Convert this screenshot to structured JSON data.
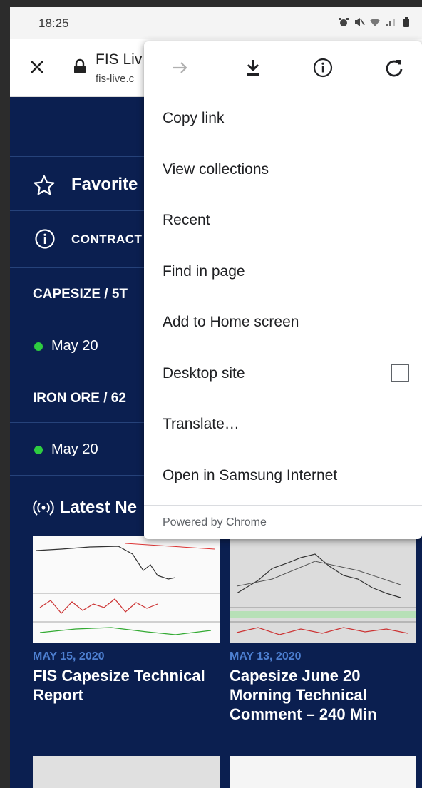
{
  "status_bar": {
    "time": "18:25",
    "icons": [
      "alarm-icon",
      "mute-icon",
      "wifi-icon",
      "signal-icon",
      "battery-icon"
    ]
  },
  "browser": {
    "page_title": "FIS Liv",
    "page_host": "fis-live.c"
  },
  "page": {
    "favorites_label": "Favorite",
    "contracts_label": "CONTRACT",
    "items": [
      {
        "name": "CAPESIZE / 5T",
        "date": "May 20"
      },
      {
        "name": "IRON ORE / 62",
        "date": "May 20"
      }
    ],
    "latest_news_label": "Latest Ne",
    "news": [
      {
        "date": "MAY 15, 2020",
        "title": "FIS Capesize Technical Report"
      },
      {
        "date": "MAY 13, 2020",
        "title": "Capesize June 20 Morning Technical Comment – 240 Min"
      }
    ]
  },
  "menu": {
    "top_icons": [
      "forward-arrow-icon",
      "download-icon",
      "info-icon",
      "refresh-icon"
    ],
    "items": [
      "Copy link",
      "View collections",
      "Recent",
      "Find in page",
      "Add to Home screen",
      "Desktop site",
      "Translate…",
      "Open in Samsung Internet"
    ],
    "desktop_site_checked": false,
    "powered_by": "Powered by Chrome"
  },
  "colors": {
    "page_bg": "#0b1f50",
    "news_date": "#4d7fd1",
    "status_dot": "#2ecc40"
  }
}
